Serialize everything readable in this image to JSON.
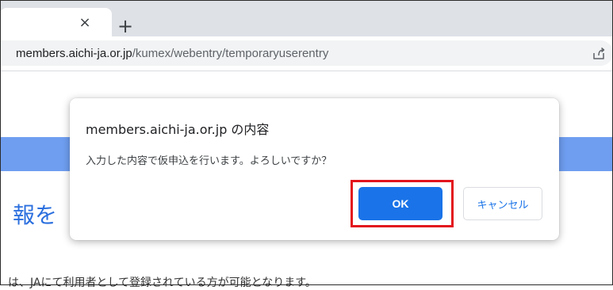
{
  "browser": {
    "tab": {
      "close_glyph": "×",
      "close_icon": "close-icon"
    },
    "new_tab_glyph": "+",
    "new_tab_icon": "plus-icon",
    "address_bar": {
      "host": "members.aichi-ja.or.jp",
      "path": "/kumex/webentry/temporaryuserentry"
    },
    "share_icon": "share-icon"
  },
  "page": {
    "header_color": "#6f9ef1",
    "heading_partial": "報を",
    "body_text_partial": "は、JAにて利用者として登録されている方が可能となります。"
  },
  "dialog": {
    "title": "members.aichi-ja.or.jp の内容",
    "message": "入力した内容で仮申込を行います。よろしいですか？",
    "ok_label": "OK",
    "cancel_label": "キャンセル",
    "accent_color": "#1a73e8",
    "highlight_color": "#e3141d"
  }
}
